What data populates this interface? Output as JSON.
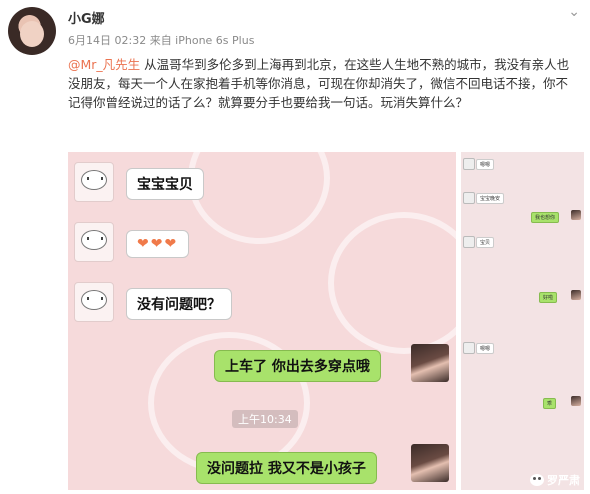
{
  "post": {
    "username": "小G娜",
    "meta": "6月14日 02:32 来自 iPhone 6s Plus",
    "mention": "@Mr_凡先生",
    "text": " 从温哥华到多伦多到上海再到北京，在这些人生地不熟的城市，我没有亲人也没朋友，每天一个人在家抱着手机等你消息，可现在你却消失了，微信不回电话不接，你不记得你曾经说过的话了么？就算要分手也要给我一句话。玩消失算什么？"
  },
  "chat": {
    "messages": [
      {
        "text": "宝宝宝贝",
        "side": "left"
      },
      {
        "text": "❤❤❤",
        "side": "left"
      },
      {
        "text": "没有问题吧？",
        "side": "left"
      },
      {
        "text": "上车了 你出去多穿点哦",
        "side": "right"
      },
      {
        "text": "没问题拉 我又不是小孩子",
        "side": "right"
      }
    ],
    "timestamp": "上午10:34"
  },
  "side_chat": {
    "lines": [
      "嗯嗯",
      "宝宝晚安",
      "我也想你",
      "宝贝",
      "好啦",
      "嗯嗯",
      "乖"
    ]
  },
  "watermark": {
    "text": "罗严肃"
  },
  "colors": {
    "mention": "#eb7350",
    "bubble_green": "#a8e26b",
    "chat_bg": "#f6dadb"
  }
}
